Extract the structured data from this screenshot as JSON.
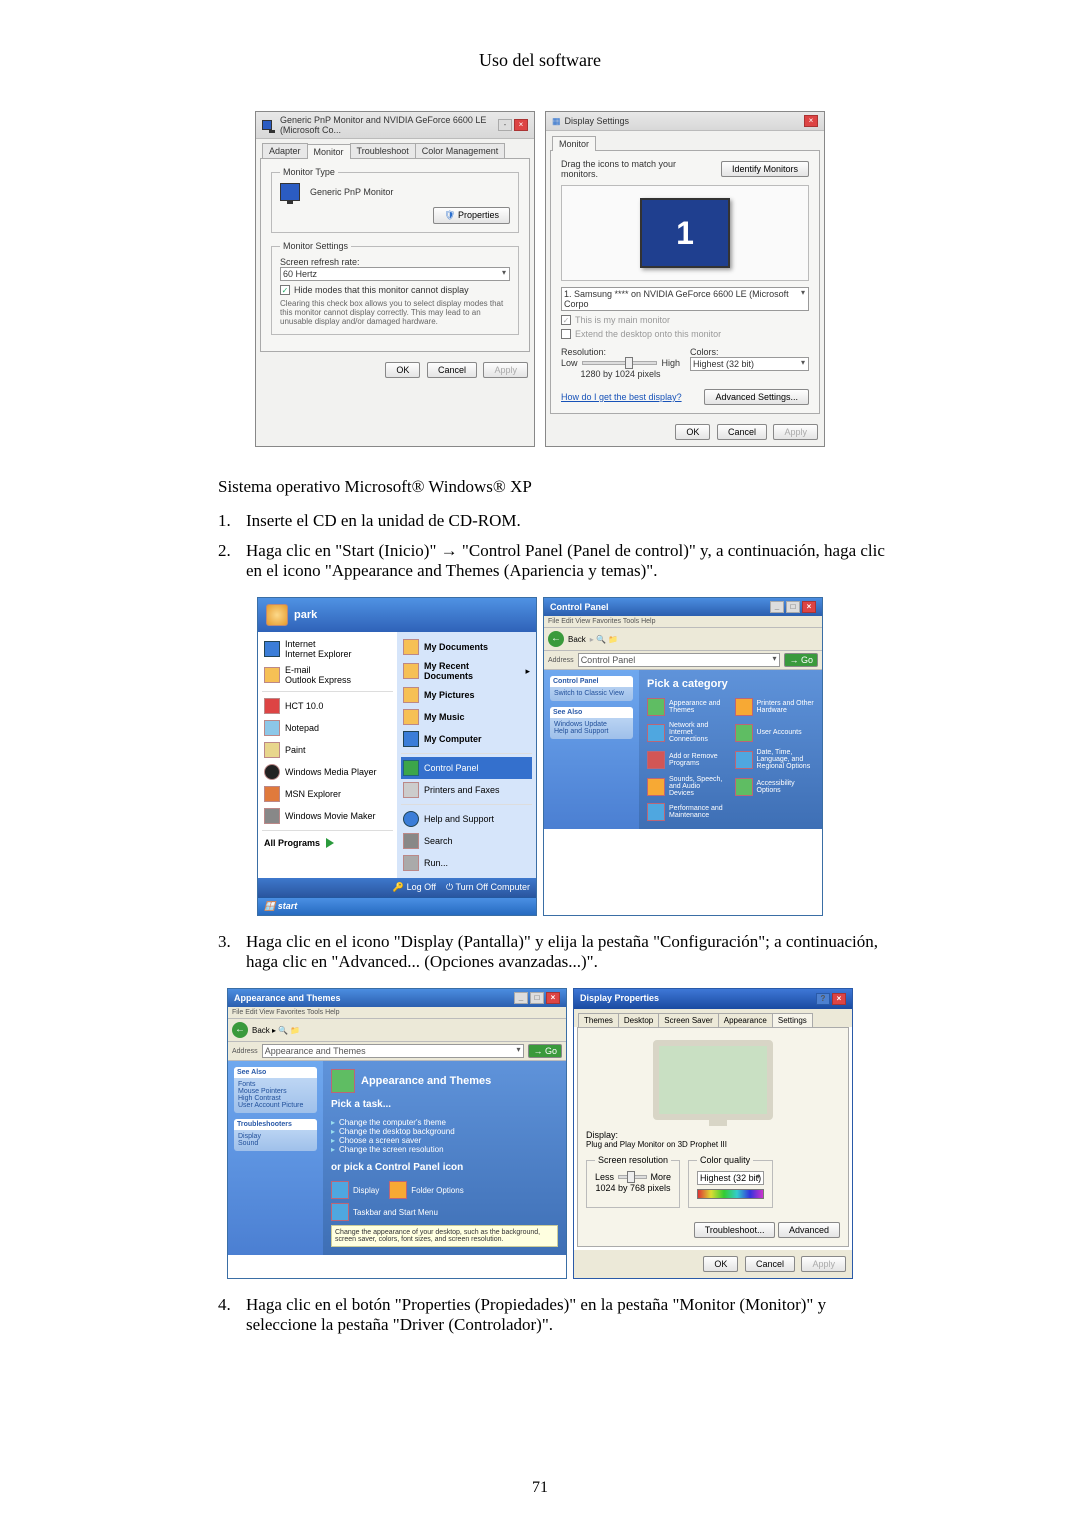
{
  "header": {
    "title": "Uso del software"
  },
  "monitor_dialog": {
    "title": "Generic PnP Monitor and NVIDIA GeForce 6600 LE (Microsoft Co...",
    "tabs": [
      "Adapter",
      "Monitor",
      "Troubleshoot",
      "Color Management"
    ],
    "active_tab": "Monitor",
    "section_type": "Monitor Type",
    "monitor_name": "Generic PnP Monitor",
    "properties_btn": "Properties",
    "section_settings": "Monitor Settings",
    "refresh_label": "Screen refresh rate:",
    "refresh_value": "60 Hertz",
    "hide_modes_label": "Hide modes that this monitor cannot display",
    "hide_modes_desc": "Clearing this check box allows you to select display modes that this monitor cannot display correctly. This may lead to an unusable display and/or damaged hardware.",
    "ok": "OK",
    "cancel": "Cancel",
    "apply": "Apply"
  },
  "display_settings": {
    "title": "Display Settings",
    "tab": "Monitor",
    "drag_text": "Drag the icons to match your monitors.",
    "identify_btn": "Identify Monitors",
    "monitor_select": "1. Samsung **** on NVIDIA GeForce 6600 LE (Microsoft Corpo",
    "main_monitor": "This is my main monitor",
    "extend_desktop": "Extend the desktop onto this monitor",
    "resolution_label": "Resolution:",
    "low": "Low",
    "high": "High",
    "res_value": "1280 by 1024 pixels",
    "colors_label": "Colors:",
    "colors_value": "Highest (32 bit)",
    "best_display_link": "How do I get the best display?",
    "adv_btn": "Advanced Settings...",
    "ok": "OK",
    "cancel": "Cancel",
    "apply": "Apply"
  },
  "body_xp_intro": "Sistema operativo Microsoft® Windows® XP",
  "steps": {
    "s1": "Inserte el CD en la unidad de CD-ROM.",
    "s2": "Haga clic en \"Start (Inicio)\" → \"Control Panel (Panel de control)\" y, a continuación, haga clic en el icono \"Appearance and Themes (Apariencia y temas)\".",
    "s3": "Haga clic en el icono \"Display (Pantalla)\" y elija la pestaña \"Configuración\"; a continuación, haga clic en \"Advanced... (Opciones avanzadas...)\".",
    "s4": "Haga clic en el botón \"Properties (Propiedades)\" en la pestaña \"Monitor (Monitor)\" y seleccione la pestaña \"Driver (Controlador)\"."
  },
  "xp_start": {
    "user": "park",
    "left": [
      "Internet\nInternet Explorer",
      "E-mail\nOutlook Express",
      "HCT 10.0",
      "Notepad",
      "Paint",
      "Windows Media Player",
      "MSN Explorer",
      "Windows Movie Maker"
    ],
    "all_programs": "All Programs",
    "right": [
      "My Documents",
      "My Recent Documents",
      "My Pictures",
      "My Music",
      "My Computer",
      "Control Panel",
      "Printers and Faxes",
      "Help and Support",
      "Search",
      "Run..."
    ],
    "log_off": "Log Off",
    "turn_off": "Turn Off Computer",
    "start_btn": "start"
  },
  "control_panel": {
    "title": "Control Panel",
    "menu": "File   Edit   View   Favorites   Tools   Help",
    "back": "Back",
    "address_label": "Address",
    "address": "Control Panel",
    "left_panel1_hd": "Control Panel",
    "left_panel1_item": "Switch to Classic View",
    "left_panel2_hd": "See Also",
    "left_panel2_items": [
      "Windows Update",
      "Help and Support"
    ],
    "pick_category": "Pick a category",
    "cats": [
      "Appearance and Themes",
      "Printers and Other Hardware",
      "Network and Internet Connections",
      "User Accounts",
      "Add or Remove Programs",
      "Date, Time, Language, and Regional Options",
      "Sounds, Speech, and Audio Devices",
      "Accessibility Options",
      "Performance and Maintenance"
    ]
  },
  "appearance_themes": {
    "title": "Appearance and Themes",
    "menu": "File   Edit   View   Favorites   Tools   Help",
    "address": "Appearance and Themes",
    "left_panel1_hd": "See Also",
    "left_panel1_items": [
      "Fonts",
      "Mouse Pointers",
      "High Contrast",
      "User Account Picture"
    ],
    "left_panel2_hd": "Troubleshooters",
    "left_panel2_items": [
      "Display",
      "Sound"
    ],
    "heading": "Appearance and Themes",
    "pick_task": "Pick a task...",
    "tasks": [
      "Change the computer's theme",
      "Change the desktop background",
      "Choose a screen saver",
      "Change the screen resolution"
    ],
    "or_pick": "or pick a Control Panel icon",
    "icons": [
      "Display",
      "Taskbar and Start Menu",
      "Folder Options"
    ],
    "icon_desc": "Change the appearance of your desktop, such as the background, screen saver, colors, font sizes, and screen resolution."
  },
  "display_props": {
    "title": "Display Properties",
    "tabs": [
      "Themes",
      "Desktop",
      "Screen Saver",
      "Appearance",
      "Settings"
    ],
    "active_tab": "Settings",
    "display_label": "Display:",
    "display_value": "Plug and Play Monitor on 3D Prophet III",
    "screen_res": "Screen resolution",
    "less": "Less",
    "more": "More",
    "res_value": "1024 by 768 pixels",
    "color_quality": "Color quality",
    "color_value": "Highest (32 bit)",
    "troubleshoot": "Troubleshoot...",
    "advanced": "Advanced",
    "ok": "OK",
    "cancel": "Cancel",
    "apply": "Apply"
  },
  "page_number": "71"
}
